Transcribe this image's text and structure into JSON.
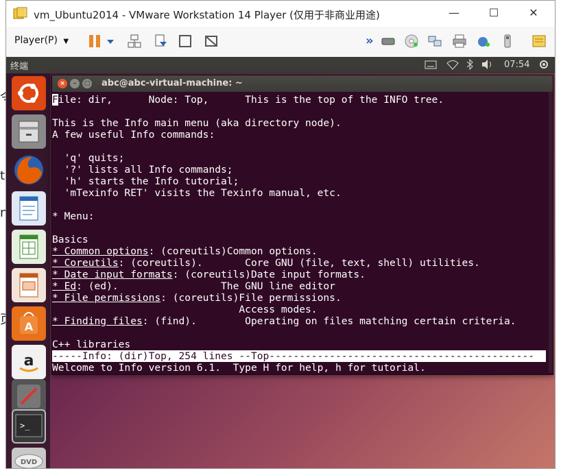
{
  "window": {
    "title": "vm_Ubuntu2014 - VMware Workstation 14 Player (仅用于非商业用途)",
    "minimize": "—",
    "maximize": "☐",
    "close": "✕"
  },
  "toolbar": {
    "player_menu": "Player(P)",
    "dropdown_arrow": "▼",
    "more": "»"
  },
  "guest_topbar": {
    "app_name": "终端",
    "time": "07:54"
  },
  "terminal": {
    "title": "abc@abc-virtual-machine: ~",
    "lines": {
      "l1_cursor": "F",
      "l1": "ile: dir,      Node: Top,      This is the top of the INFO tree.",
      "l3": "This is the Info main menu (aka directory node).",
      "l4": "A few useful Info commands:",
      "l6": "  'q' quits;",
      "l7": "  '?' lists all Info commands;",
      "l8": "  'h' starts the Info tutorial;",
      "l9": "  'mTexinfo RET' visits the Texinfo manual, etc.",
      "l11": "* Menu:",
      "l13": "Basics",
      "m1_link": "* Common options",
      "m1_rest": ": (coreutils)Common options.",
      "m2_link": "* Coreutils",
      "m2_rest": ": (coreutils).       Core GNU (file, text, shell) utilities.",
      "m3_link": "* Date input formats",
      "m3_rest": ": (coreutils)Date input formats.",
      "m4_link": "* Ed",
      "m4_rest": ": (ed).                 The GNU line editor",
      "m5_link": "* File permissions",
      "m5_rest": ": (coreutils)File permissions.",
      "m5_cont": "                               Access modes.",
      "m6_link": "* Finding files",
      "m6_rest": ": (find).        Operating on files matching certain criteria.",
      "l22": "C++ libraries",
      "status": "-----Info: (dir)Top, 254 lines --Top--------------------------------------------",
      "echo": "Welcome to Info version 6.1.  Type H for help, h for tutorial."
    }
  },
  "launcher": {
    "items": [
      "ubuntu-dash",
      "files",
      "firefox",
      "writer",
      "calc",
      "impress",
      "software-center",
      "amazon",
      "system-settings",
      "terminal",
      "dvd"
    ]
  },
  "colors": {
    "terminal_bg": "#300a24",
    "topbar_bg": "#3c3b37",
    "pause_orange": "#e8892a"
  }
}
